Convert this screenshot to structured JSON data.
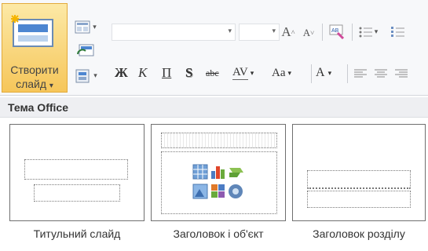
{
  "ribbon": {
    "new_slide_label_line1": "Створити",
    "new_slide_label_line2": "слайд",
    "new_slide_dropdown": "▾",
    "grow_font": "A",
    "shrink_font": "A",
    "bold": "Ж",
    "italic": "К",
    "underline": "П",
    "strikethrough": "S",
    "abc_strike": "abc",
    "char_spacing": "AV",
    "change_case": "Aa",
    "font_color": "A",
    "dropdown_glyph": "▾",
    "format_painter_text": "AB"
  },
  "gallery": {
    "header": "Тема Office",
    "layouts": [
      {
        "caption": "Титульний слайд"
      },
      {
        "caption": "Заголовок і об'єкт"
      },
      {
        "caption": "Заголовок розділу"
      }
    ]
  },
  "colors": {
    "accent_orange": "#f6c65a",
    "ribbon_bg": "#f7f8fa",
    "gallery_header_bg": "#eeeff2"
  }
}
